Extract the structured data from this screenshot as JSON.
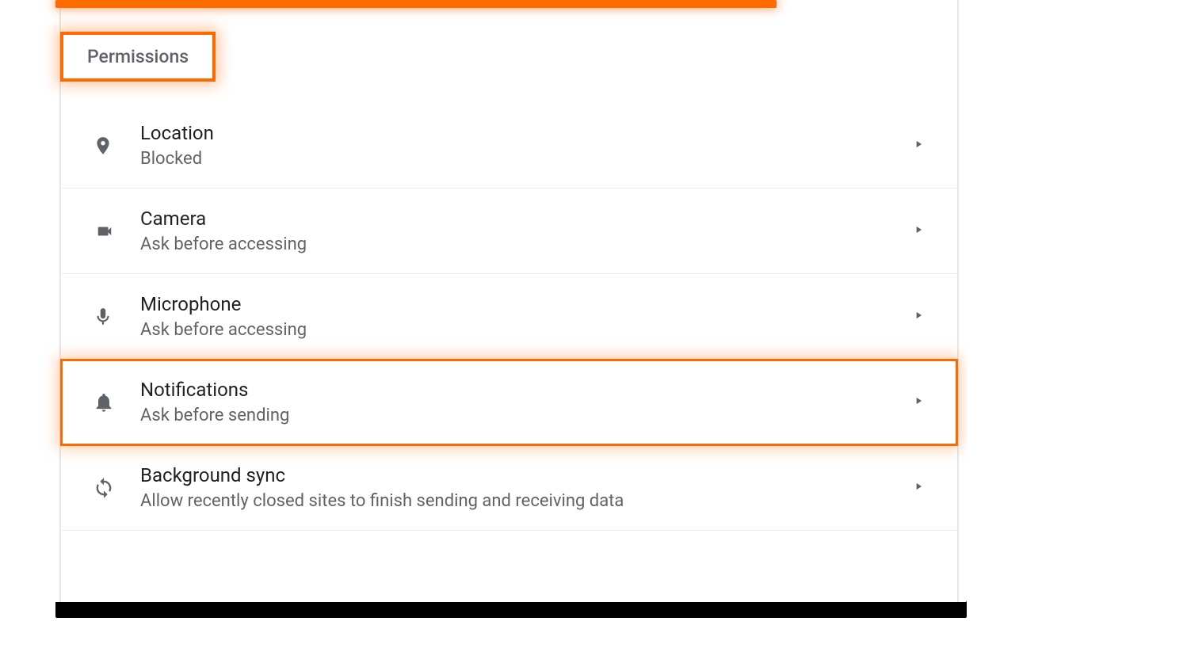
{
  "section": {
    "title": "Permissions"
  },
  "rows": [
    {
      "icon": "location",
      "title": "Location",
      "sub": "Blocked",
      "highlighted": false
    },
    {
      "icon": "camera",
      "title": "Camera",
      "sub": "Ask before accessing",
      "highlighted": false
    },
    {
      "icon": "microphone",
      "title": "Microphone",
      "sub": "Ask before accessing",
      "highlighted": false
    },
    {
      "icon": "bell",
      "title": "Notifications",
      "sub": "Ask before sending",
      "highlighted": true
    },
    {
      "icon": "sync",
      "title": "Background sync",
      "sub": "Allow recently closed sites to finish sending and receiving data",
      "highlighted": false
    }
  ],
  "colors": {
    "highlight": "#ff6a00"
  }
}
